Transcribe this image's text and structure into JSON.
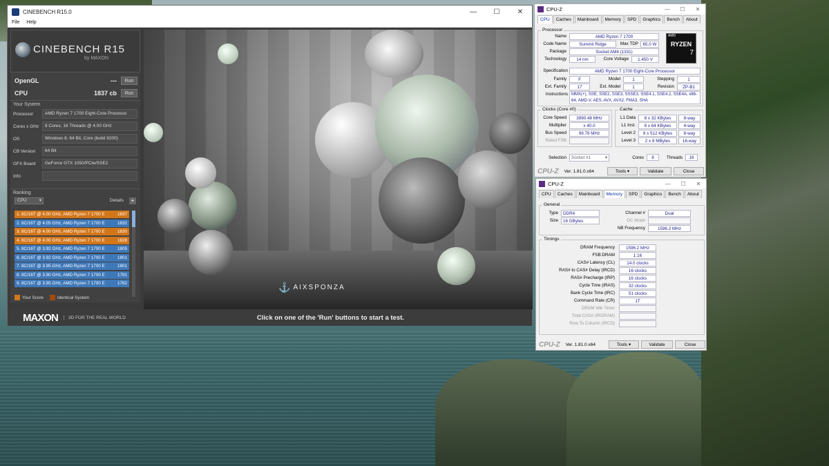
{
  "cinebench": {
    "title": "CINEBENCH R15.0",
    "menu": [
      "File",
      "Help"
    ],
    "logo": {
      "name": "CINEBENCH R15",
      "by": "by MAXON"
    },
    "results": [
      {
        "label": "OpenGL",
        "value": "---",
        "button": "Run"
      },
      {
        "label": "CPU",
        "value": "1837 cb",
        "button": "Run"
      }
    ],
    "your_system": {
      "header": "Your System",
      "rows": [
        {
          "key": "Processor",
          "value": "AMD Ryzen 7 1700 Eight-Core Processo"
        },
        {
          "key": "Cores x GHz",
          "value": "8 Cores, 16 Threads @ 4.00 GHz"
        },
        {
          "key": "OS",
          "value": "Windows 8, 64 Bit, Core (build 9200)"
        },
        {
          "key": "CB Version",
          "value": "64 Bit"
        },
        {
          "key": "GFX Board",
          "value": "GeForce GTX 1050/PCIe/SSE2"
        },
        {
          "key": "Info",
          "value": ""
        }
      ]
    },
    "ranking": {
      "header": "Ranking",
      "select": "CPU",
      "details": "Details",
      "rows": [
        {
          "text": "1. 8C/16T @ 4.00 GHz, AMD Ryzen 7 1700 E",
          "score": "1837",
          "kind": "o"
        },
        {
          "text": "2. 8C/16T @ 4.05 GHz, AMD Ryzen 7 1700 E",
          "score": "1832",
          "kind": "b"
        },
        {
          "text": "3. 8C/16T @ 4.00 GHz, AMD Ryzen 7 1700 E",
          "score": "1830",
          "kind": "o"
        },
        {
          "text": "4. 8C/16T @ 4.00 GHz, AMD Ryzen 7 1700 E",
          "score": "1828",
          "kind": "o"
        },
        {
          "text": "5. 8C/16T @ 3.92 GHz, AMD Ryzen 7 1700 E",
          "score": "1805",
          "kind": "b"
        },
        {
          "text": "6. 8C/16T @ 3.92 GHz, AMD Ryzen 7 1700 E",
          "score": "1801",
          "kind": "b"
        },
        {
          "text": "7. 8C/16T @ 3.95 GHz, AMD Ryzen 7 1700 E",
          "score": "1801",
          "kind": "b"
        },
        {
          "text": "8. 8C/16T @ 3.90 GHz, AMD Ryzen 7 1700 E",
          "score": "1791",
          "kind": "b"
        },
        {
          "text": "9. 8C/16T @ 3.95 GHz, AMD Ryzen 7 1700 E",
          "score": "1762",
          "kind": "b"
        }
      ],
      "legend_your": "Your Score",
      "legend_identical": "Identical System"
    },
    "watermark": "AIXSPONZA",
    "maxon": "MAXON",
    "maxon_sub": "3D FOR THE REAL WORLD",
    "status": "Click on one of the 'Run' buttons to start a test."
  },
  "cpuz_cpu": {
    "title": "CPU-Z",
    "tabs": [
      "CPU",
      "Caches",
      "Mainboard",
      "Memory",
      "SPD",
      "Graphics",
      "Bench",
      "About"
    ],
    "processor": {
      "header": "Processor",
      "name": "AMD Ryzen 7 1700",
      "code_name": "Summit Ridge",
      "max_tdp": "65.0 W",
      "package": "Socket AM4 (1331)",
      "technology": "14 nm",
      "core_voltage": "1.450 V",
      "specification": "AMD Ryzen 7 1700 Eight-Core Processor",
      "family": "F",
      "model": "1",
      "stepping": "1",
      "ext_family": "17",
      "ext_model": "1",
      "revision": "ZP-B1",
      "instructions": "MMX(+), SSE, SSE2, SSE3, SSSE3, SSE4.1, SSE4.2, SSE4A, x86-64, AMD-V, AES, AVX, AVX2, FMA3, SHA"
    },
    "labels": {
      "name": "Name",
      "code_name": "Code Name",
      "max_tdp": "Max TDP",
      "package": "Package",
      "technology": "Technology",
      "core_voltage": "Core Voltage",
      "specification": "Specification",
      "family": "Family",
      "model": "Model",
      "stepping": "Stepping",
      "ext_family": "Ext. Family",
      "ext_model": "Ext. Model",
      "revision": "Revision",
      "instructions": "Instructions"
    },
    "clocks": {
      "header": "Clocks (Core #0)",
      "core_speed_l": "Core Speed",
      "core_speed": "3990.48 MHz",
      "multiplier_l": "Multiplier",
      "multiplier": "x 40.0",
      "bus_speed_l": "Bus Speed",
      "bus_speed": "99.76 MHz",
      "rated_fsb_l": "Rated FSB"
    },
    "cache": {
      "header": "Cache",
      "rows": [
        {
          "l": "L1 Data",
          "v": "8 x 32 KBytes",
          "w": "8-way"
        },
        {
          "l": "L1 Inst.",
          "v": "8 x 64 KBytes",
          "w": "4-way"
        },
        {
          "l": "Level 2",
          "v": "8 x 512 KBytes",
          "w": "8-way"
        },
        {
          "l": "Level 3",
          "v": "2 x 8 MBytes",
          "w": "16-way"
        }
      ]
    },
    "selection_l": "Selection",
    "selection": "Socket #1",
    "cores_l": "Cores",
    "cores": "8",
    "threads_l": "Threads",
    "threads": "16",
    "logo": "CPU-Z",
    "version": "Ver. 1.81.0.x64",
    "tools": "Tools",
    "validate": "Validate",
    "close": "Close",
    "badge": {
      "brand": "AMD",
      "line": "RYZEN",
      "num": "7"
    }
  },
  "cpuz_mem": {
    "title": "CPU-Z",
    "tabs": [
      "CPU",
      "Caches",
      "Mainboard",
      "Memory",
      "SPD",
      "Graphics",
      "Bench",
      "About"
    ],
    "general": {
      "header": "General",
      "type_l": "Type",
      "type": "DDR4",
      "size_l": "Size",
      "size": "16 GBytes",
      "channel_l": "Channel #",
      "channel": "Dual",
      "dc_mode_l": "DC Mode",
      "nb_freq_l": "NB Frequency",
      "nb_freq": "1596.2 MHz"
    },
    "timings": {
      "header": "Timings",
      "rows": [
        {
          "l": "DRAM Frequency",
          "v": "1596.2 MHz",
          "dim": false
        },
        {
          "l": "FSB:DRAM",
          "v": "1:16",
          "dim": false
        },
        {
          "l": "CAS# Latency (CL)",
          "v": "14.0 clocks",
          "dim": false
        },
        {
          "l": "RAS# to CAS# Delay (tRCD)",
          "v": "16 clocks",
          "dim": false
        },
        {
          "l": "RAS# Precharge (tRP)",
          "v": "16 clocks",
          "dim": false
        },
        {
          "l": "Cycle Time (tRAS)",
          "v": "32 clocks",
          "dim": false
        },
        {
          "l": "Bank Cycle Time (tRC)",
          "v": "51 clocks",
          "dim": false
        },
        {
          "l": "Command Rate (CR)",
          "v": "1T",
          "dim": false
        },
        {
          "l": "DRAM Idle Timer",
          "v": "",
          "dim": true
        },
        {
          "l": "Total CAS# (tRDRAM)",
          "v": "",
          "dim": true
        },
        {
          "l": "Row To Column (tRCD)",
          "v": "",
          "dim": true
        }
      ]
    },
    "logo": "CPU-Z",
    "version": "Ver. 1.81.0.x64",
    "tools": "Tools",
    "validate": "Validate",
    "close": "Close"
  }
}
